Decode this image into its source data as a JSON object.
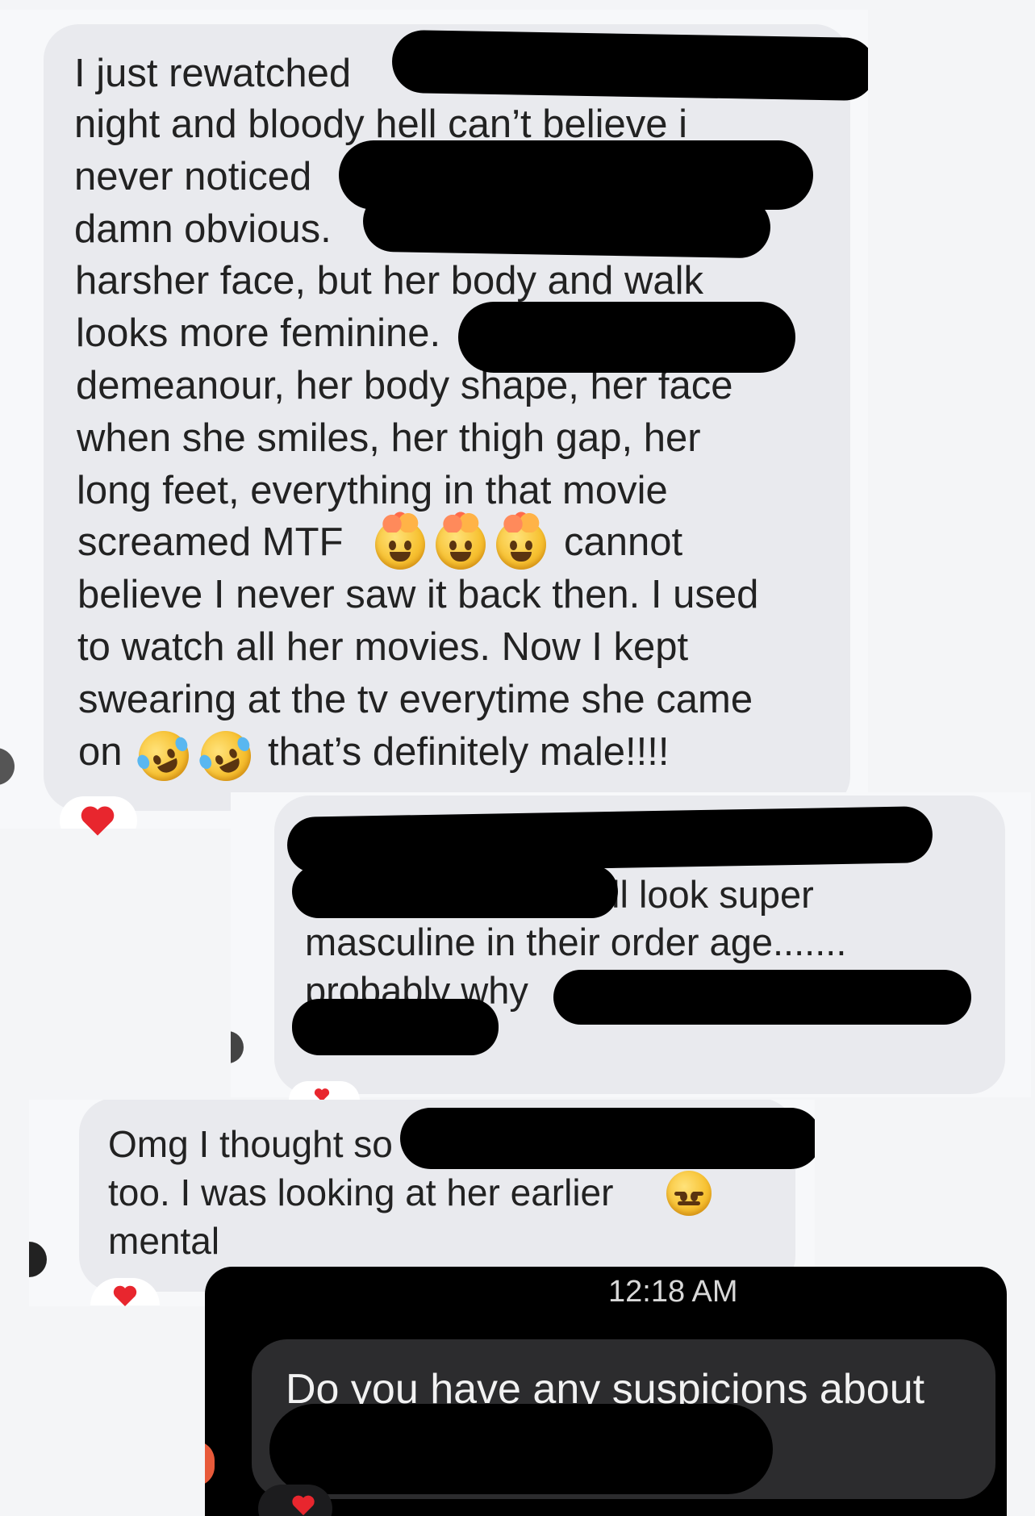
{
  "messages": {
    "first": {
      "lines": [
        "I just rewatched",
        "night and bloody hell can’t believe i",
        "never noticed",
        "damn obvious.",
        "harsher face, but her body and walk",
        "looks more feminine.",
        "demeanour, her body shape, her face",
        "when she smiles, her thigh gap, her",
        "long feet, everything in that movie",
        "screamed MTF",
        "cannot",
        "believe I never saw it back then. I used",
        "to watch all her movies. Now I kept",
        "swearing at the tv everytime she came",
        "on",
        "that’s definitely male!!!!"
      ],
      "emoji_exploding": [
        "exploding-head-emoji",
        "exploding-head-emoji",
        "exploding-head-emoji"
      ],
      "emoji_laughing": [
        "rolling-on-floor-laughing-emoji",
        "rolling-on-floor-laughing-emoji"
      ],
      "reaction": "heart"
    },
    "second": {
      "lines": [
        "ll look super",
        "masculine in their order age.......",
        "probably why"
      ],
      "reaction": "heart"
    },
    "third": {
      "lines": [
        "Omg I thought so",
        "too.  I was looking at her earlier",
        "mental"
      ],
      "emoji_expressionless": "expressionless-face-emoji",
      "reaction": "heart"
    },
    "fourth": {
      "timestamp": "12:18 AM",
      "lines": [
        "Do you have any suspicions about"
      ],
      "reaction": "heart"
    }
  },
  "colors": {
    "light_bg": "#f4f5f7",
    "bubble_light": "#e9eaee",
    "dark_bg": "#000000",
    "bubble_dark": "#2c2c2e",
    "heart": "#e8262e"
  }
}
